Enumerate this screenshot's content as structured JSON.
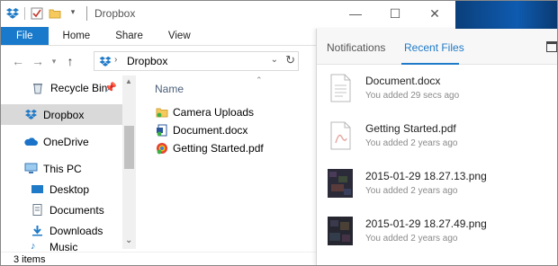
{
  "window": {
    "title": "Dropbox",
    "minimize": "—",
    "maximize": "☐",
    "close": "✕"
  },
  "ribbon": {
    "tabs": [
      "File",
      "Home",
      "Share",
      "View"
    ]
  },
  "address": {
    "path": "Dropbox"
  },
  "nav": {
    "items": [
      "Recycle Bin",
      "Dropbox",
      "OneDrive",
      "This PC",
      "Desktop",
      "Documents",
      "Downloads",
      "Music"
    ],
    "selected": "Dropbox"
  },
  "content": {
    "column_header": "Name",
    "files": [
      {
        "name": "Camera Uploads",
        "icon": "folder-icon"
      },
      {
        "name": "Document.docx",
        "icon": "word-doc-icon"
      },
      {
        "name": "Getting Started.pdf",
        "icon": "pdf-icon"
      }
    ]
  },
  "status": {
    "count": "3 items"
  },
  "dropbox_panel": {
    "tabs": [
      "Notifications",
      "Recent Files"
    ],
    "active_tab": "Recent Files",
    "recent_files": [
      {
        "name": "Document.docx",
        "added": "You added 29 secs ago",
        "icon": "document-thumb"
      },
      {
        "name": "Getting Started.pdf",
        "added": "You added 2 years ago",
        "icon": "pdf-thumb"
      },
      {
        "name": "2015-01-29 18.27.13.png",
        "added": "You added 2 years ago",
        "icon": "image-thumb"
      },
      {
        "name": "2015-01-29 18.27.49.png",
        "added": "You added 2 years ago",
        "icon": "image-thumb"
      }
    ]
  },
  "colors": {
    "accent": "#1979ca",
    "dropbox_blue": "#1f7ac7",
    "selected_bg": "#d9d9d9"
  }
}
